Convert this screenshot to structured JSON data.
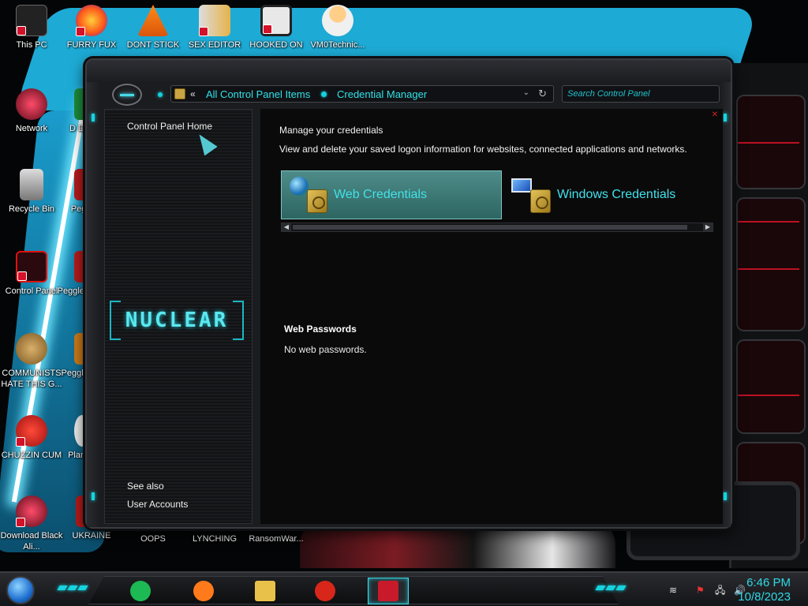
{
  "desktop": {
    "icons_left": [
      {
        "label": "This PC"
      },
      {
        "label": "Network"
      },
      {
        "label": "Recycle Bin"
      },
      {
        "label": "Control Panel"
      },
      {
        "label": "COMMUNISTS HATE THIS G..."
      },
      {
        "label": "CHUZZIN CUM"
      },
      {
        "label": "Download Black Ali..."
      }
    ],
    "icons_second_col": [
      {
        "label": "FURRY FUX"
      },
      {
        "label": "D DUM"
      },
      {
        "label": "Peggle"
      },
      {
        "label": "Peggle De"
      },
      {
        "label": "Peggle of Wa"
      },
      {
        "label": "Plan Zo"
      },
      {
        "label": "UKRAINE"
      }
    ],
    "icons_top_row": [
      {
        "label": "DONT STICK"
      },
      {
        "label": "SEX EDITOR"
      },
      {
        "label": "HOOKED ON"
      },
      {
        "label": "VM0Technic..."
      }
    ],
    "icons_bottom_row": [
      {
        "label": "OOPS"
      },
      {
        "label": "LYNCHING"
      },
      {
        "label": "RansomWar..."
      }
    ]
  },
  "window": {
    "address": {
      "back_chevron": "«",
      "crumbs": [
        "All Control Panel Items",
        "Credential Manager"
      ],
      "dropdown_glyph": "⌄",
      "refresh_glyph": "↻"
    },
    "search": {
      "placeholder": "Search Control Panel"
    },
    "left_pane": {
      "home_link": "Control Panel Home",
      "logo_text": "NUCLEAR",
      "see_also": "See also",
      "user_accounts": "User Accounts"
    },
    "content": {
      "heading": "Manage your credentials",
      "subheading": "View and delete your saved logon information for websites, connected applications and networks.",
      "web_credentials": "Web Credentials",
      "windows_credentials": "Windows Credentials",
      "section_title": "Web Passwords",
      "section_body": "No web passwords."
    }
  },
  "taskbar": {
    "apps": [
      {
        "icon": "spotify-icon",
        "color": "#1db954"
      },
      {
        "icon": "firefox-icon",
        "color": "#ff7a1a"
      },
      {
        "icon": "file-explorer-icon",
        "color": "#e8c14a"
      },
      {
        "icon": "flash-icon",
        "color": "#d8261a"
      },
      {
        "icon": "control-panel-icon",
        "color": "#c81a2a",
        "active": true
      }
    ],
    "time": "6:46 PM",
    "date": "10/8/2023"
  },
  "colors": {
    "accent": "#2fe2e8",
    "window_bg": "#0a0a0b",
    "selected_tile": "#3f7a77",
    "wallpaper_blue": "#1fb3e0",
    "alert_red": "#e3142a"
  }
}
